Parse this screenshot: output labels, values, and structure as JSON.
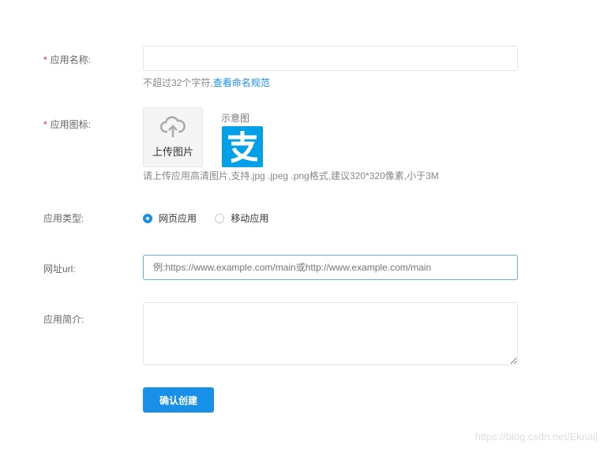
{
  "required_mark": "*",
  "name": {
    "label": "应用名称:",
    "value": "",
    "hint": "不超过32个字符,",
    "link": "查看命名规范"
  },
  "icon": {
    "label": "应用图标:",
    "upload": "上传图片",
    "sample_label": "示意图",
    "hint": "请上传应用高清图片,支持.jpg .jpeg .png格式,建议320*320像素,小于3M"
  },
  "type": {
    "label": "应用类型:",
    "options": [
      "网页应用",
      "移动应用"
    ],
    "selected": "网页应用"
  },
  "url": {
    "label": "网址url:",
    "placeholder": "例:https://www.example.com/main或http://www.example.com/main"
  },
  "intro": {
    "label": "应用简介:",
    "value": ""
  },
  "submit": "确认创建",
  "watermark": "https://blog.csdn.net/Eknaij",
  "colors": {
    "primary": "#1890e8",
    "alipay": "#00a0e9"
  }
}
